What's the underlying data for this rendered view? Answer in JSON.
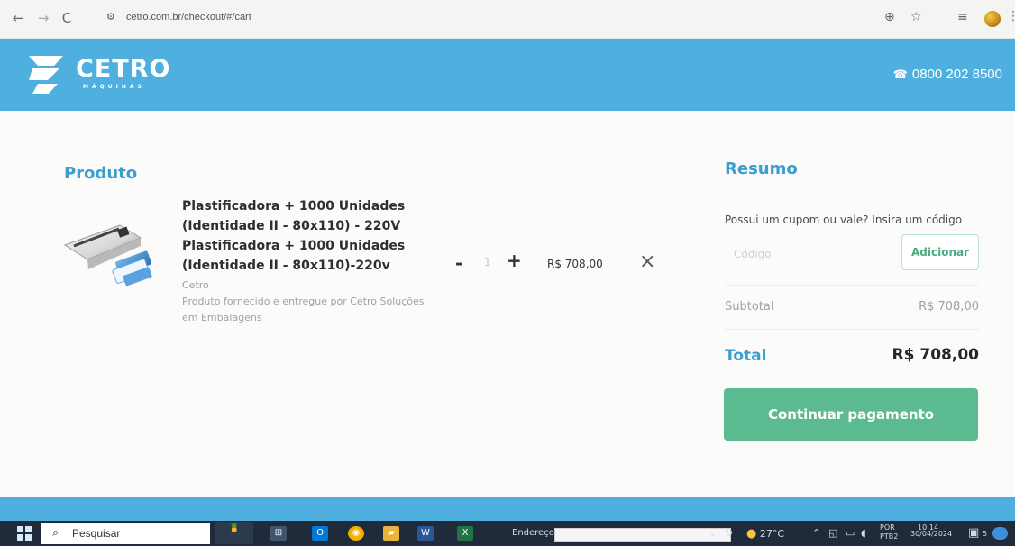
{
  "browser": {
    "url": "cetro.com.br/checkout/#/cart",
    "icons": [
      "back-arrow-icon",
      "forward-arrow-icon",
      "reload-icon",
      "site-info-icon",
      "zoom-icon",
      "bookmark-star-icon",
      "reading-list-icon",
      "profile-avatar-icon",
      "menu-icon"
    ]
  },
  "header": {
    "brand_name": "CETRO",
    "brand_subtitle": "MÁQUINAS",
    "phone": "0800 202 8500",
    "background_color": "#4fb0df"
  },
  "cart": {
    "title": "Produto",
    "item": {
      "name": "Plastificadora + 1000 Unidades (Identidade II - 80x110) - 220V Plastificadora + 1000 Unidades (Identidade II - 80x110)-220v",
      "seller": "Cetro",
      "delivery_note": "Produto fornecido e entregue por Cetro Soluções em Embalagens",
      "quantity": "1",
      "decrement_label": "-",
      "increment_label": "+",
      "price": "R$ 708,00",
      "remove_label": "×"
    }
  },
  "summary": {
    "title": "Resumo",
    "coupon_prompt": "Possui um cupom ou vale? Insira um código",
    "coupon_placeholder": "Código",
    "coupon_button": "Adicionar",
    "subtotal_label": "Subtotal",
    "subtotal_value": "R$ 708,00",
    "total_label": "Total",
    "total_value": "R$ 708,00",
    "checkout_button": "Continuar pagamento",
    "accent_color": "#3a9fd0",
    "button_color": "#5cba91"
  },
  "taskbar": {
    "search_label": "Pesquisar",
    "address_label": "Endereço",
    "weather": "27°C",
    "language": "POR",
    "keyboard": "PTB2",
    "time": "10:14",
    "date": "30/04/2024",
    "notifications_badge": "5"
  }
}
